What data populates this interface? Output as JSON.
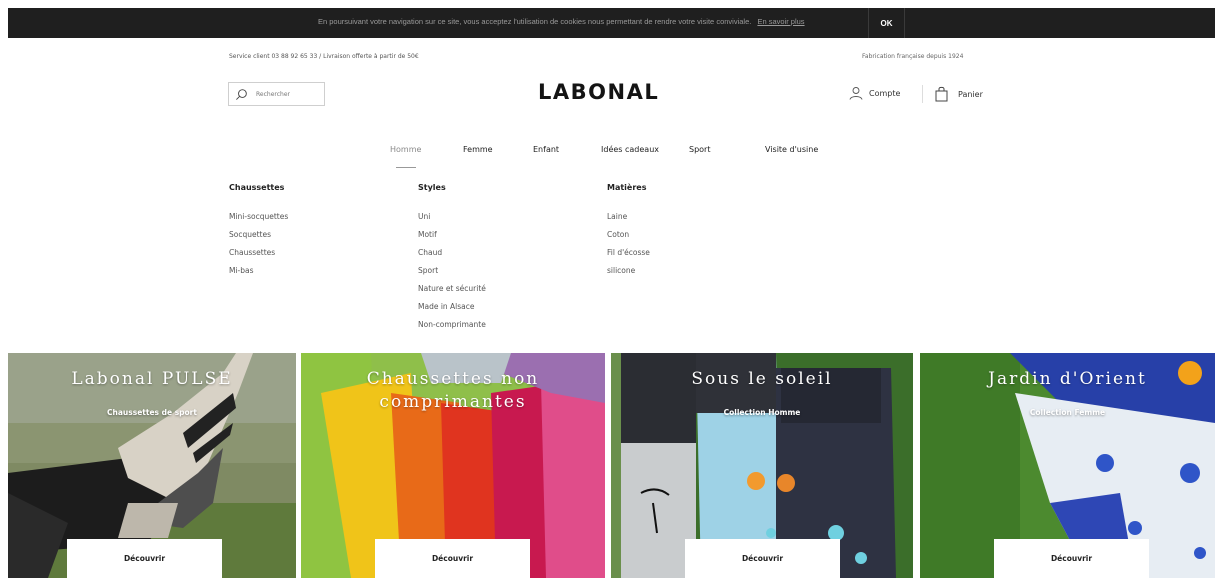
{
  "cookie": {
    "text": "En poursuivant votre navigation sur ce site, vous acceptez l'utilisation de cookies nous permettant de rendre votre visite conviviale.",
    "link": "En savoir plus",
    "ok": "OK"
  },
  "header": {
    "service": "Service client 03 88 92 65 33 / Livraison offerte à partir de 50€",
    "fabrication": "Fabrication française depuis 1924",
    "search_placeholder": "Rechercher",
    "logo": "LABONAL",
    "account": "Compte",
    "cart": "Panier"
  },
  "nav": [
    "Homme",
    "Femme",
    "Enfant",
    "Idées cadeaux",
    "Sport",
    "Visite d'usine"
  ],
  "menu": {
    "col1": {
      "title": "Chaussettes",
      "items": [
        "Mini-socquettes",
        "Socquettes",
        "Chaussettes",
        "Mi-bas"
      ]
    },
    "col2": {
      "title": "Styles",
      "items": [
        "Uni",
        "Motif",
        "Chaud",
        "Sport",
        "Nature et sécurité",
        "Made in Alsace",
        "Non-comprimante"
      ]
    },
    "col3": {
      "title": "Matières",
      "items": [
        "Laine",
        "Coton",
        "Fil d'écosse",
        "silicone"
      ]
    }
  },
  "tiles": [
    {
      "title": "Labonal PULSE",
      "sub": "Chaussettes de sport",
      "button": "Découvrir"
    },
    {
      "title": "Chaussettes non comprimantes",
      "sub": "",
      "button": "Découvrir"
    },
    {
      "title": "Sous le soleil",
      "sub": "Collection Homme",
      "button": "Découvrir"
    },
    {
      "title": "Jardin d'Orient",
      "sub": "Collection Femme",
      "button": "Découvrir"
    }
  ],
  "icons": {
    "search": "search-icon",
    "account": "user-icon",
    "cart": "shopping-bag-icon"
  }
}
